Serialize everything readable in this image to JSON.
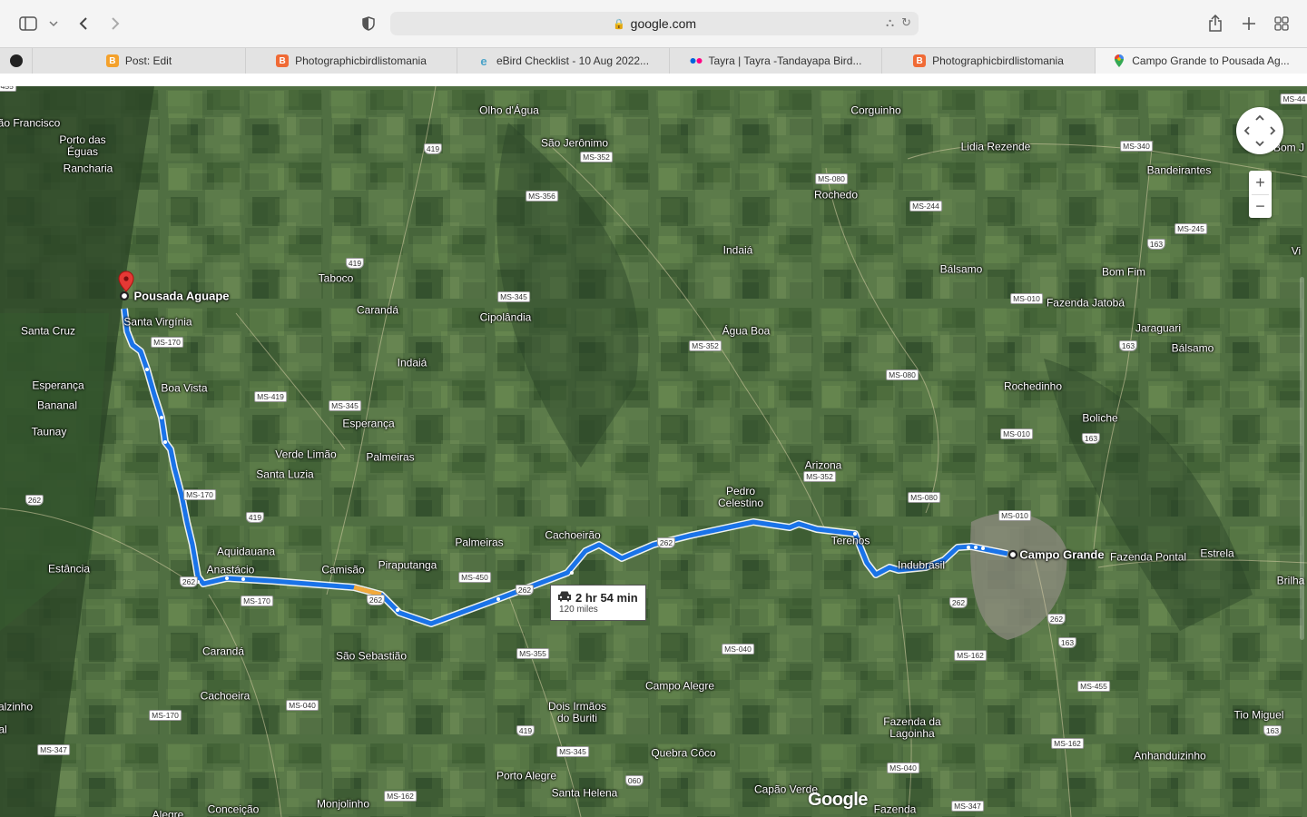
{
  "browser": {
    "url": "google.com",
    "tabs": [
      {
        "label": "",
        "favicon": "site-icon",
        "color": "#222222"
      },
      {
        "label": "Post: Edit",
        "favicon": "blogger-icon",
        "color": "#f4a12b"
      },
      {
        "label": "Photographicbirdlistomania",
        "favicon": "blogger-icon",
        "color": "#f06a35"
      },
      {
        "label": "eBird Checklist - 10 Aug 2022...",
        "favicon": "ebird-icon",
        "color": "#4aa3c8"
      },
      {
        "label": "Tayra | Tayra -Tandayapa Bird...",
        "favicon": "flickr-icon",
        "color": "#ff0084"
      },
      {
        "label": "Photographicbirdlistomania",
        "favicon": "blogger-icon",
        "color": "#f06a35"
      },
      {
        "label": "Campo Grande to Pousada Ag...",
        "favicon": "google-maps-icon",
        "color": "#34a853"
      }
    ]
  },
  "map": {
    "route": {
      "duration": "2 hr 54 min",
      "distance": "120 miles",
      "color": "#1a73e8"
    },
    "origin": "Campo Grande",
    "destination": "Pousada Aguape",
    "places": [
      "ão Francisco",
      "Porto das Éguas",
      "Rancharia",
      "Olho d'Água",
      "São Jerônimo",
      "Corguinho",
      "Lidia Rezende",
      "Bom J",
      "Bandeirantes",
      "Rochedo",
      "Taboco",
      "Indaiá",
      "Bálsamo",
      "Bom Fim",
      "Vi",
      "Santa Cruz",
      "Santa Virgínia",
      "Carandá",
      "Cipolândia",
      "Fazenda Jatobá",
      "Água Boa",
      "Jaraguari",
      "Bálsamo",
      "Esperança",
      "Boa Vista",
      "Indaiá",
      "Rochedinho",
      "Bananal",
      "Esperança",
      "Boliche",
      "Taunay",
      "Verde Limão",
      "Palmeiras",
      "Arizona",
      "Santa Luzia",
      "Pedro Celestino",
      "Cachoeirão",
      "Terenos",
      "Estrela",
      "Palmeiras",
      "Aquidauana",
      "Anastácio",
      "Estância",
      "Camisão",
      "Piraputanga",
      "Indubrasil",
      "Fazenda Pontal",
      "Brilha",
      "Carandá",
      "São Sebastião",
      "Campo Alegre",
      "Cachoeira",
      "alzinho",
      "al",
      "Dois Irmãos do Buriti",
      "Fazenda da Lagoinha",
      "Tio Miguel",
      "Quebra Côco",
      "Anhanduizinho",
      "Porto Alegre",
      "Capão Verde",
      "Santa Helena",
      "Alegre",
      "Conceição",
      "Monjolinho",
      "Fazenda"
    ],
    "road_shields": [
      "MS-44",
      "419",
      "MS-352",
      "MS-340",
      "MS-080",
      "MS-356",
      "MS-244",
      "MS-245",
      "163",
      "419",
      "MS-170",
      "MS-345",
      "MS-010",
      "MS-352",
      "163",
      "MS-419",
      "MS-345",
      "MS-080",
      "MS-010",
      "163",
      "MS-170",
      "MS-352",
      "MS-080",
      "MS-010",
      "262",
      "419",
      "262",
      "MS-450",
      "262",
      "262",
      "262",
      "262",
      "MS-170",
      "262",
      "163",
      "MS-040",
      "MS-355",
      "MS-162",
      "MS-455",
      "MS-040",
      "MS-170",
      "419",
      "MS-347",
      "MS-345",
      "MS-162",
      "163",
      "MS-040",
      "060",
      "MS-162",
      "MS-347",
      "MS-455"
    ],
    "attribution": "Google",
    "zoom_in": "+",
    "zoom_out": "−"
  }
}
